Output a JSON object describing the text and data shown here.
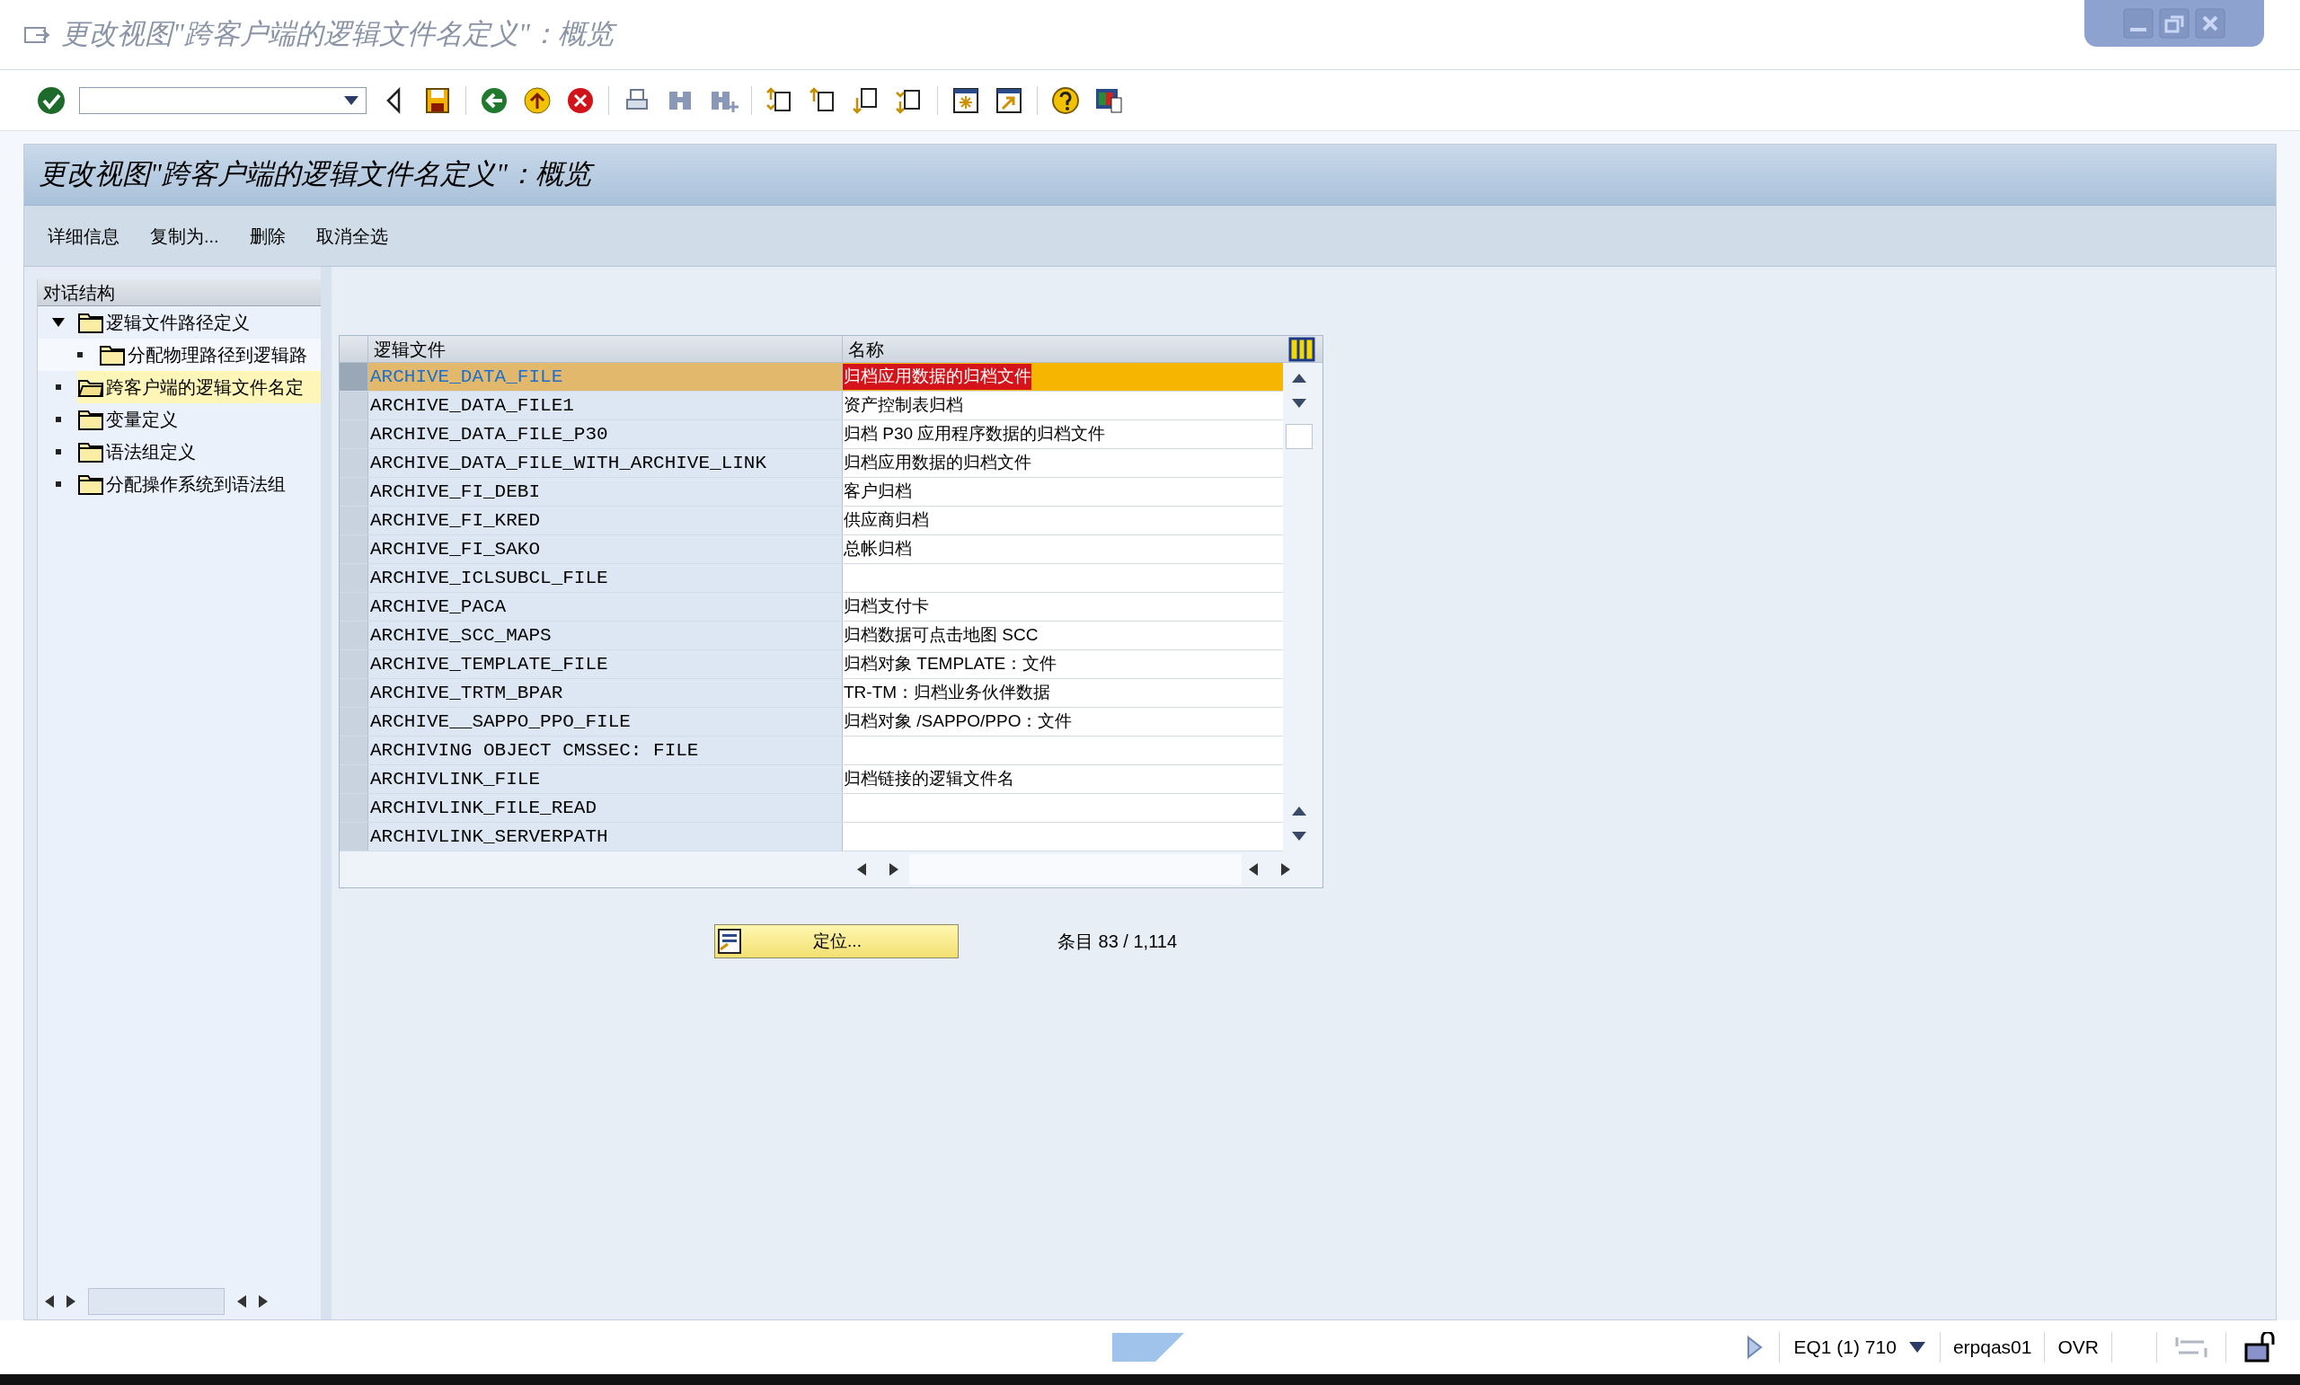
{
  "window": {
    "title": "更改视图\"跨客户端的逻辑文件名定义\"：概览"
  },
  "screen_title": "更改视图\"跨客户端的逻辑文件名定义\"：概览",
  "menu": [
    "详细信息",
    "复制为...",
    "删除",
    "取消全选"
  ],
  "tree": {
    "header": "对话结构",
    "items": [
      {
        "label": "逻辑文件路径定义",
        "expanded": true,
        "selected": false,
        "children": [
          {
            "label": "分配物理路径到逻辑路",
            "selected": false
          }
        ]
      },
      {
        "label": "跨客户端的逻辑文件名定",
        "selected": true
      },
      {
        "label": "变量定义",
        "selected": false
      },
      {
        "label": "语法组定义",
        "selected": false
      },
      {
        "label": "分配操作系统到语法组",
        "selected": false
      }
    ]
  },
  "table": {
    "columns": [
      "逻辑文件",
      "名称"
    ],
    "rows": [
      {
        "file": "ARCHIVE_DATA_FILE",
        "name": "归档应用数据的归档文件",
        "selected": true
      },
      {
        "file": "ARCHIVE_DATA_FILE1",
        "name": "资产控制表归档",
        "selected": false
      },
      {
        "file": "ARCHIVE_DATA_FILE_P30",
        "name": "归档 P30 应用程序数据的归档文件",
        "selected": false
      },
      {
        "file": "ARCHIVE_DATA_FILE_WITH_ARCHIVE_LINK",
        "name": "归档应用数据的归档文件",
        "selected": false
      },
      {
        "file": "ARCHIVE_FI_DEBI",
        "name": "客户归档",
        "selected": false
      },
      {
        "file": "ARCHIVE_FI_KRED",
        "name": "供应商归档",
        "selected": false
      },
      {
        "file": "ARCHIVE_FI_SAKO",
        "name": "总帐归档",
        "selected": false
      },
      {
        "file": "ARCHIVE_ICLSUBCL_FILE",
        "name": "",
        "selected": false
      },
      {
        "file": "ARCHIVE_PACA",
        "name": "归档支付卡",
        "selected": false
      },
      {
        "file": "ARCHIVE_SCC_MAPS",
        "name": "归档数据可点击地图 SCC",
        "selected": false
      },
      {
        "file": "ARCHIVE_TEMPLATE_FILE",
        "name": "归档对象 TEMPLATE：文件",
        "selected": false
      },
      {
        "file": "ARCHIVE_TRTM_BPAR",
        "name": "TR-TM：归档业务伙伴数据",
        "selected": false
      },
      {
        "file": "ARCHIVE__SAPPO_PPO_FILE",
        "name": "归档对象 /SAPPO/PPO：文件",
        "selected": false
      },
      {
        "file": "ARCHIVING OBJECT CMSSEC: FILE",
        "name": "",
        "selected": false
      },
      {
        "file": "ARCHIVLINK_FILE",
        "name": "归档链接的逻辑文件名",
        "selected": false
      },
      {
        "file": "ARCHIVLINK_FILE_READ",
        "name": "",
        "selected": false
      },
      {
        "file": "ARCHIVLINK_SERVERPATH",
        "name": "",
        "selected": false
      }
    ]
  },
  "position_button": "定位...",
  "entry_count": "条目 83 / 1,114",
  "status_bar": {
    "system": "EQ1 (1) 710",
    "server": "erpqas01",
    "mode": "OVR"
  }
}
